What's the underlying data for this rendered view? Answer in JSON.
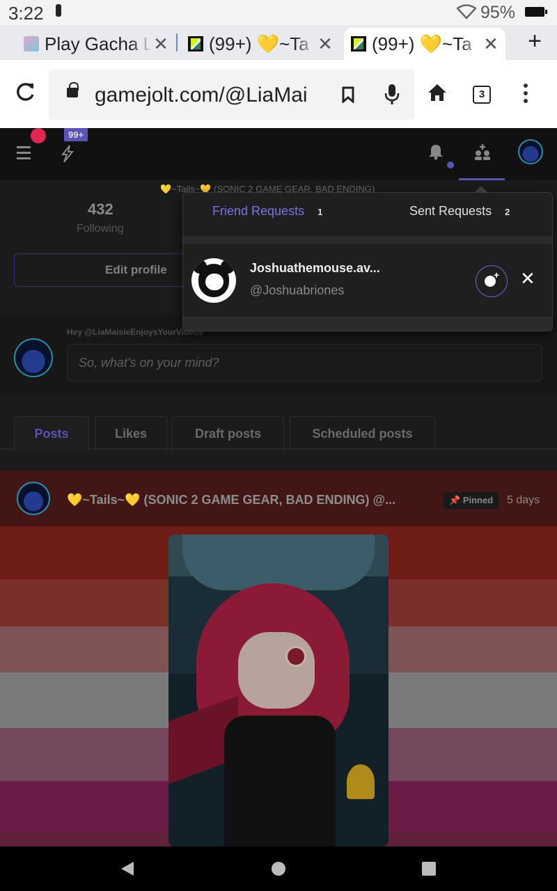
{
  "status": {
    "time": "3:22",
    "battery": "95%"
  },
  "browser": {
    "tabs": [
      {
        "title": "Play Gacha L"
      },
      {
        "title": "(99+) 💛~Ta"
      },
      {
        "title": "(99+) 💛~Ta"
      }
    ],
    "url": "gamejolt.com/@LiaMai",
    "tab_count": "3"
  },
  "site": {
    "notif_badge": "99+",
    "profile_name_partial": "💛~Tails~💛 (SONIC 2 GAME GEAR, BAD ENDING)",
    "stat_number": "432",
    "stat_label": "Following",
    "edit_profile": "Edit profile",
    "composer_hint": "Hey @LiaMaisieEnjoysYourVideos",
    "composer_placeholder": "So, what's on your mind?",
    "tabs": [
      "Posts",
      "Likes",
      "Draft posts",
      "Scheduled posts"
    ],
    "post": {
      "title": "💛~Tails~💛 (SONIC 2 GAME GEAR, BAD ENDING) @...",
      "pinned": "Pinned",
      "age": "5 days"
    }
  },
  "friend_dropdown": {
    "friend_requests_label": "Friend Requests",
    "friend_requests_count": "1",
    "sent_requests_label": "Sent Requests",
    "sent_requests_count": "2",
    "request": {
      "display_name": "Joshuathemouse.av...",
      "username": "@Joshuabriones"
    },
    "decline_symbol": "✕"
  },
  "colors": {
    "accent": "#5c53b8",
    "brand_red": "#e0274f"
  }
}
